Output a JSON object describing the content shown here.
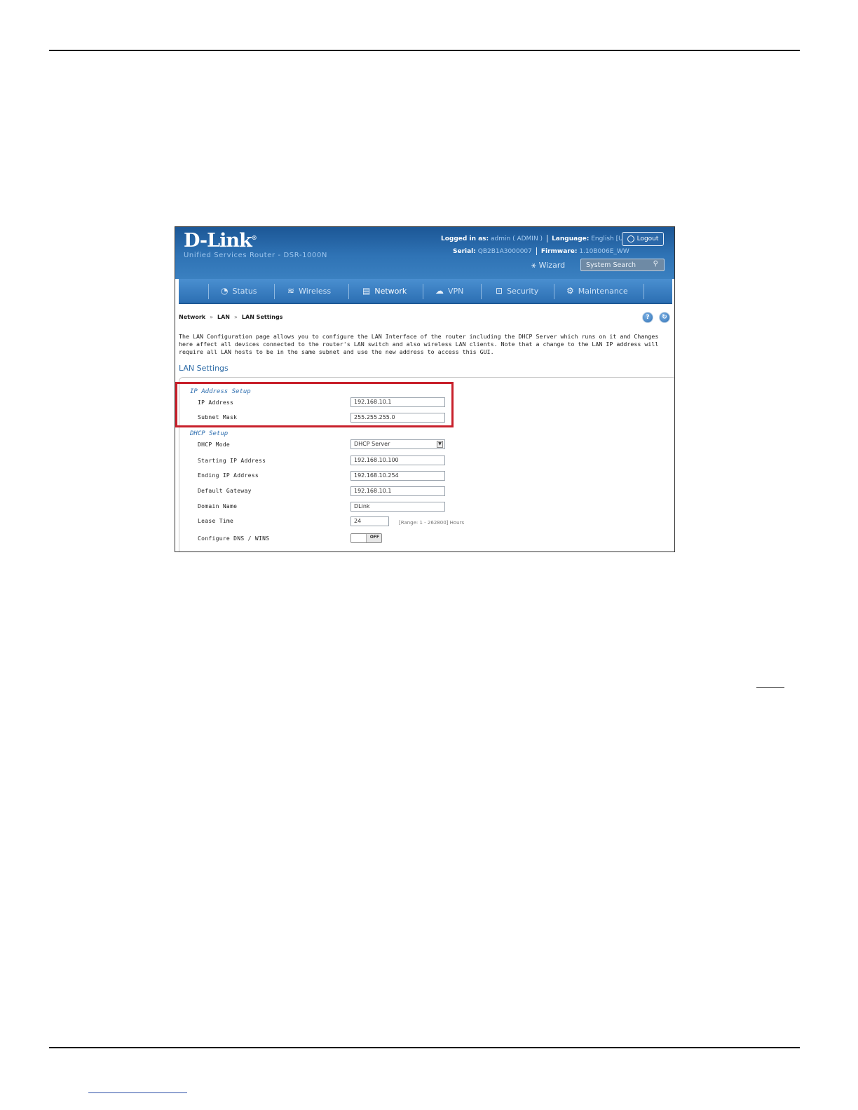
{
  "header": {
    "brand": "D-Link",
    "brand_mark": "®",
    "product": "Unified Services Router - DSR-1000N",
    "logged_in_label": "Logged in as:",
    "logged_in_user": "admin ( ADMIN )",
    "language_label": "Language:",
    "language_value": "English [US]",
    "logout_label": "Logout",
    "serial_label": "Serial:",
    "serial_value": "QB2B1A3000007",
    "firmware_label": "Firmware:",
    "firmware_value": "1.10B006E_WW",
    "wizard_label": "Wizard",
    "search_placeholder": "System Search"
  },
  "nav": {
    "items": [
      {
        "label": "Status",
        "icon": "speedometer-icon"
      },
      {
        "label": "Wireless",
        "icon": "wifi-icon"
      },
      {
        "label": "Network",
        "icon": "monitor-icon",
        "active": true
      },
      {
        "label": "VPN",
        "icon": "cloud-icon"
      },
      {
        "label": "Security",
        "icon": "lock-icon"
      },
      {
        "label": "Maintenance",
        "icon": "gears-icon"
      }
    ]
  },
  "breadcrumb": {
    "items": [
      "Network",
      "LAN",
      "LAN Settings"
    ],
    "separator": "»"
  },
  "intro": "The LAN Configuration page allows you to configure the LAN Interface of the router including the DHCP Server which runs on it and Changes here affect all devices connected to the router's LAN switch and also wireless LAN clients. Note that a change to the LAN IP address will require all LAN hosts to be in the same subnet and use the new address to access this GUI.",
  "section_title": "LAN Settings",
  "ip_setup": {
    "title": "IP Address Setup",
    "ip_label": "IP Address",
    "ip_value": "192.168.10.1",
    "mask_label": "Subnet Mask",
    "mask_value": "255.255.255.0"
  },
  "dhcp_setup": {
    "title": "DHCP Setup",
    "mode_label": "DHCP Mode",
    "mode_value": "DHCP Server",
    "start_label": "Starting IP Address",
    "start_value": "192.168.10.100",
    "end_label": "Ending IP Address",
    "end_value": "192.168.10.254",
    "gateway_label": "Default Gateway",
    "gateway_value": "192.168.10.1",
    "domain_label": "Domain Name",
    "domain_value": "DLink",
    "lease_label": "Lease Time",
    "lease_value": "24",
    "lease_hint": "[Range: 1 - 262800] Hours",
    "dns_label": "Configure DNS / WINS",
    "dns_toggle": "OFF"
  },
  "colors": {
    "highlight_box": "#c8202b",
    "header_blue": "#2f73b5"
  }
}
